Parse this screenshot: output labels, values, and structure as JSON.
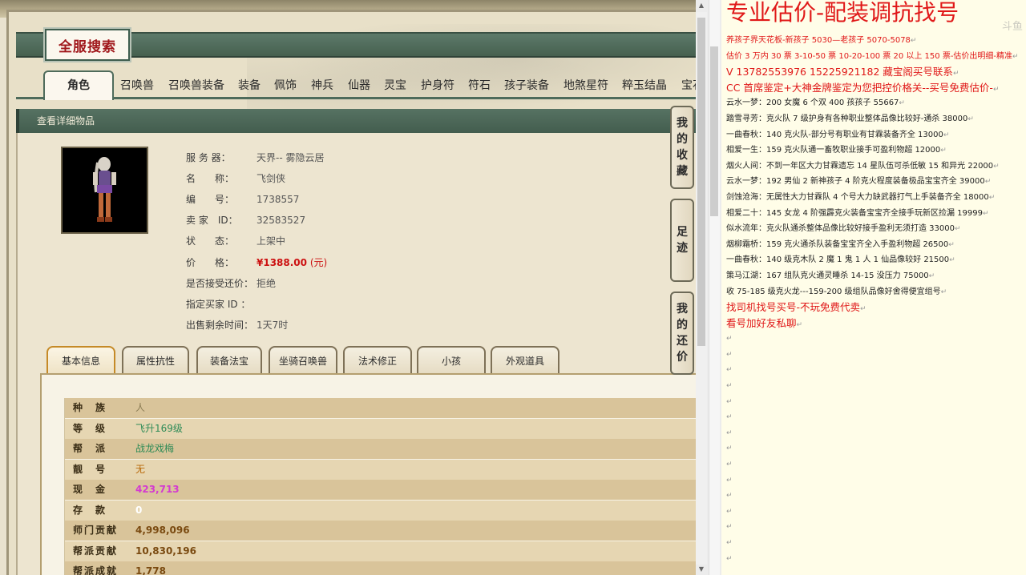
{
  "logo": "全服搜索",
  "nav_tabs": [
    "角色",
    "召唤兽",
    "召唤兽装备",
    "装备",
    "佩饰",
    "神兵",
    "仙器",
    "灵宝",
    "护身符",
    "符石",
    "孩子装备",
    "地煞星符",
    "粹玉结晶",
    "宝石"
  ],
  "detail_header": "查看详细物品",
  "info": [
    {
      "label": "服 务 器：",
      "value": "天界-- 雾隐云居"
    },
    {
      "label": "名　　称：",
      "value": "飞剑侠"
    },
    {
      "label": "编　　号：",
      "value": "1738557"
    },
    {
      "label": "卖 家　ID：",
      "value": "32583527"
    },
    {
      "label": "状　　态：",
      "value": "上架中"
    },
    {
      "label": "价　　格：",
      "value": "¥1388.00",
      "unit": "(元)"
    },
    {
      "label": "是否接受还价：",
      "value": "拒绝"
    },
    {
      "label": "指定买家 ID ：",
      "value": ""
    },
    {
      "label": "出售剩余时间：",
      "value": "1天7时"
    }
  ],
  "sub_tabs": [
    "基本信息",
    "属性抗性",
    "装备法宝",
    "坐骑召唤兽",
    "法术修正",
    "小孩",
    "外观道具"
  ],
  "stats": [
    {
      "label": "种　族",
      "value": "人",
      "color": "#8c7d55"
    },
    {
      "label": "等　级",
      "value": "飞升169级",
      "color": "#2e8b57"
    },
    {
      "label": "帮　派",
      "value": "战龙戏梅",
      "color": "#2e8b57"
    },
    {
      "label": "靓　号",
      "value": "无",
      "color": "#b8690a"
    },
    {
      "label": "现　金",
      "value": "423,713",
      "color": "#d43ad0"
    },
    {
      "label": "存　款",
      "value": "0",
      "color": "#ffffff"
    },
    {
      "label": "师门贡献",
      "value": "4,998,096",
      "color": "#7a4a10"
    },
    {
      "label": "帮派贡献",
      "value": "10,830,196",
      "color": "#7a4a10"
    },
    {
      "label": "帮派成就",
      "value": "1,778",
      "color": "#7a4a10"
    }
  ],
  "side_buttons": [
    {
      "label": "我的收藏",
      "chars": [
        "我",
        "的",
        "收",
        "藏"
      ]
    },
    {
      "label": "足迹",
      "chars": [
        "足",
        "迹"
      ]
    },
    {
      "label": "我的还价",
      "chars": [
        "我",
        "的",
        "还",
        "价"
      ]
    }
  ],
  "doc": {
    "title": "专业估价-配装调抗找号",
    "watermark": "斗鱼",
    "lines": [
      {
        "text": "养孩子界天花板-新孩子 5030—老孩子 5070-5078",
        "red": true
      },
      {
        "text": "估价 3 万内 30 票  3-10-50 票  10-20-100 票  20 以上 150 票-估价出明细-精准",
        "red": true
      },
      {
        "text": "V  13782553976    15225921182   藏宝阁买号联系",
        "red": true,
        "big": true
      },
      {
        "text": "CC 首席鉴定+大神金牌鉴定为您把控价格关--买号免费估价-",
        "red": true,
        "big": true
      },
      {
        "text": "云水一梦：200 女魔 6 个双 400 孩孩子 55667",
        "red": false
      },
      {
        "text": "踏雪寻芳：克火队 7 级护身有各种职业整体品像比较好-通杀 38000",
        "red": false
      },
      {
        "text": "一曲春秋：140 克火队-部分号有职业有甘霖装备齐全 13000",
        "red": false
      },
      {
        "text": "相爱一生：159 克火队通一畜牧职业接手可盈利物超 12000",
        "red": false
      },
      {
        "text": "烟火人间：不到一年区大力甘霖遗忘 14 星队伍可杀低敏 15 和异光 22000",
        "red": false
      },
      {
        "text": "云水一梦：192 男仙 2 新神孩子 4 阶克火程度装备极品宝宝齐全 39000",
        "red": false
      },
      {
        "text": "剑蚀沧海：无属性大力甘霖队 4 个号大力缺武器打气上手装备齐全 18000",
        "red": false
      },
      {
        "text": "相爱二十：145 女龙 4 阶强霹克火装备宝宝齐全接手玩新区捡漏 19999",
        "red": false
      },
      {
        "text": "似水流年：克火队通杀整体品像比较好接手盈利无须打造 33000",
        "red": false
      },
      {
        "text": "烟柳霜桥：159 克火通杀队装备宝宝齐全入手盈利物超 26500",
        "red": false
      },
      {
        "text": "一曲春秋：140 级克木队 2 魔 1 鬼 1 人 1 仙品像较好 21500",
        "red": false
      },
      {
        "text": "策马江湖：167 组队克火通灵睡杀 14-15 没压力 75000",
        "red": false
      },
      {
        "text": "收 75-185 级克火龙---159-200 级组队品像好舍得便宜组号",
        "red": false
      },
      {
        "text": "找司机找号买号-不玩免费代卖",
        "red": true,
        "big": true
      },
      {
        "text": "看号加好友私聊",
        "red": true,
        "big": true
      }
    ],
    "empty_lines": 15,
    "pilcrow": "↵"
  }
}
